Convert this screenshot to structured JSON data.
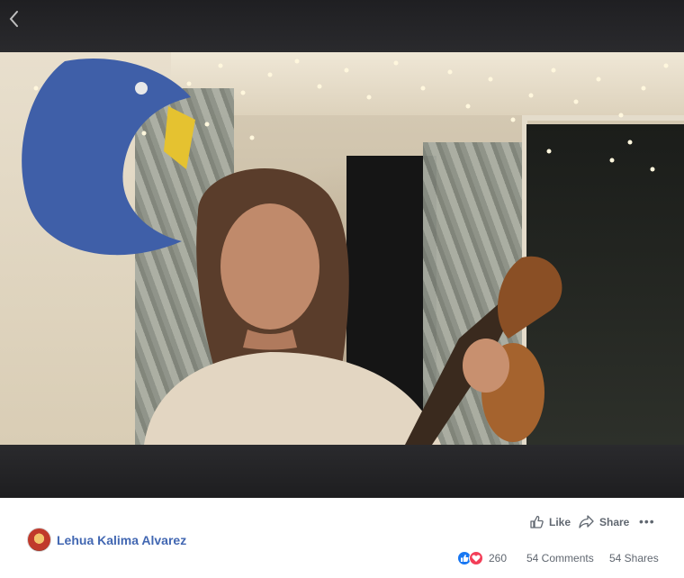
{
  "post": {
    "author": "Lehua Kalima Alvarez",
    "actions": {
      "like_label": "Like",
      "share_label": "Share",
      "more_label": "•••"
    },
    "stats": {
      "reaction_count": "260",
      "comments": "54 Comments",
      "shares": "54 Shares"
    }
  },
  "icons": {
    "back": "chevron-left-icon",
    "like": "thumbs-up-icon",
    "share": "share-arrow-icon",
    "reaction_like": "like-reaction-icon",
    "reaction_love": "love-reaction-icon"
  },
  "colors": {
    "author_link": "#4267b2",
    "secondary_text": "#606770",
    "like_reaction": "#1877f2",
    "love_reaction": "#f33e58",
    "video_letterbox": "#1e1e20"
  }
}
